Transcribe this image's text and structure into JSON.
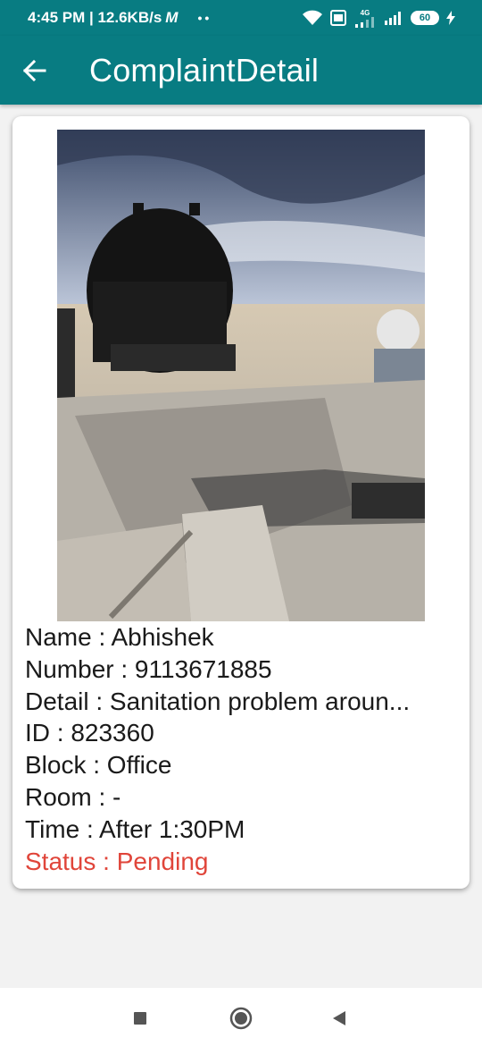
{
  "status_bar": {
    "time_speed": "4:45 PM | 12.6KB/s",
    "carrier_glyph": "M",
    "dots": "••",
    "network_label": "4G",
    "battery_level": "60"
  },
  "app_bar": {
    "title": "ComplaintDetail",
    "back_icon": "arrow-left-icon"
  },
  "complaint": {
    "photo_icon": "complaint-photo",
    "name": "Name : Abhishek",
    "number": "Number : 9113671885",
    "detail": "Detail : Sanitation problem aroun...",
    "id": "ID :  823360",
    "block": "Block : Office",
    "room": "Room : -",
    "time": "Time : After 1:30PM",
    "status": "Status : Pending"
  },
  "colors": {
    "primary": "#087c82",
    "status_pending": "#e0453a",
    "background": "#f2f2f2"
  },
  "nav_bar": {
    "recents_icon": "square-icon",
    "home_icon": "circle-icon",
    "back_icon": "triangle-back-icon"
  }
}
